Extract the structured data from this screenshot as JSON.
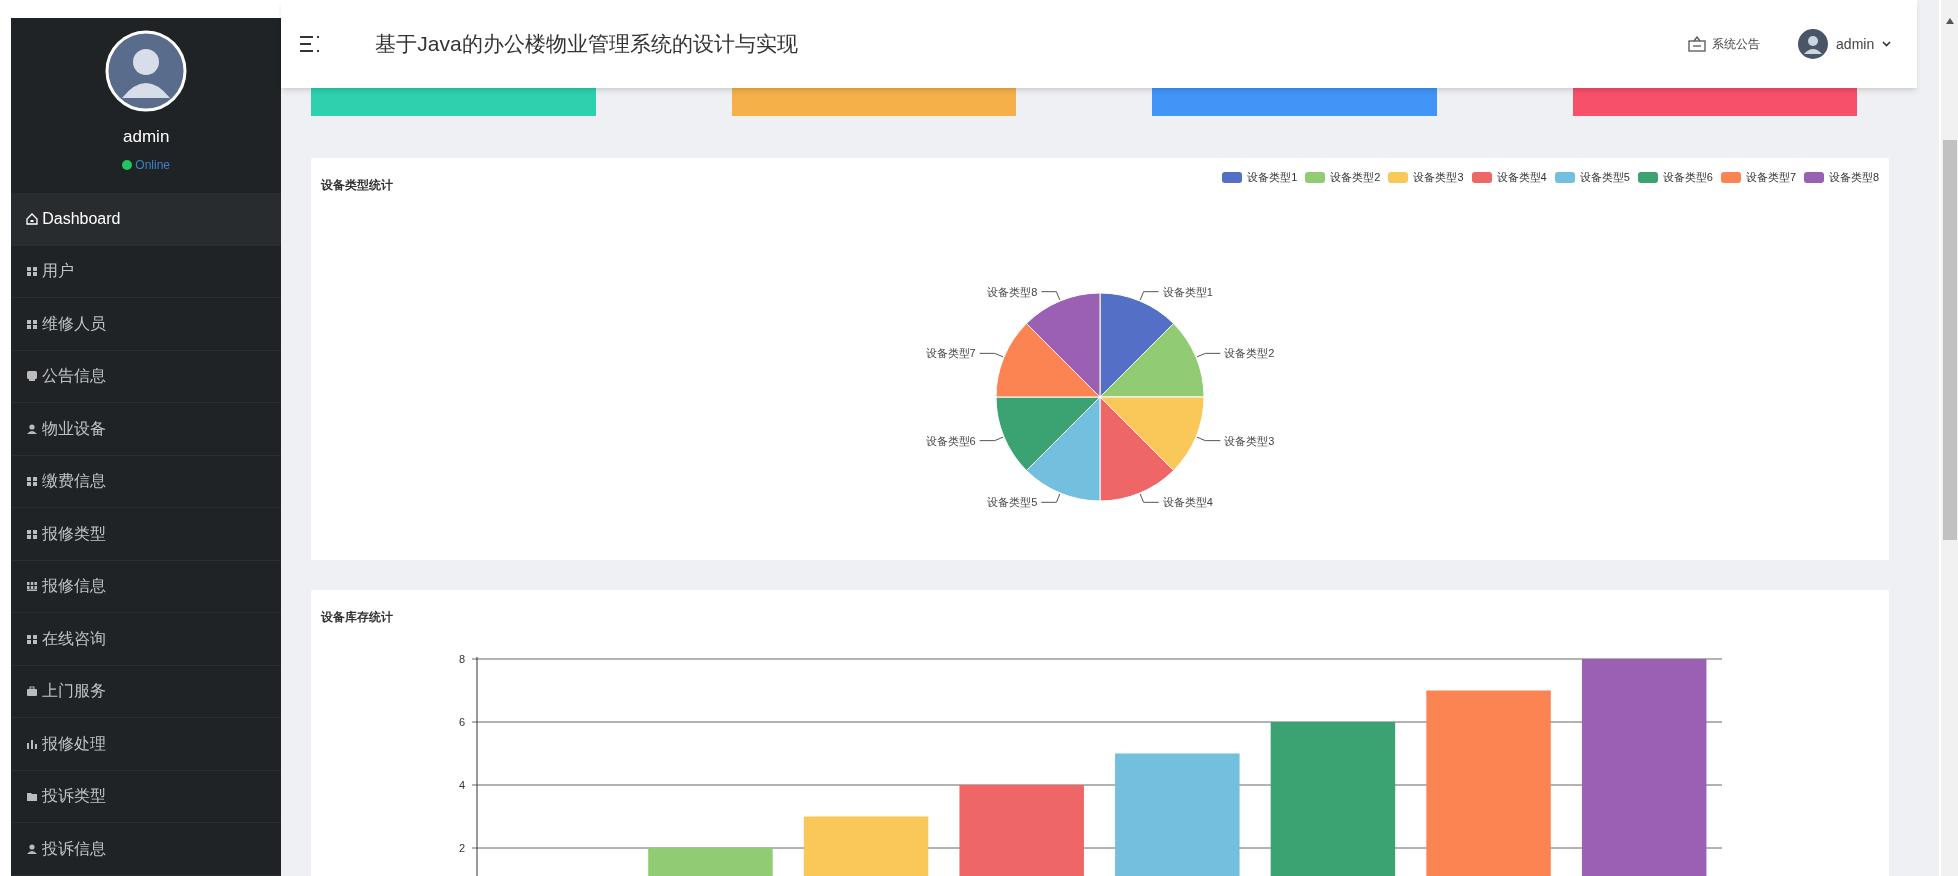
{
  "sidebar": {
    "user": {
      "name": "admin",
      "status": "Online"
    },
    "items": [
      {
        "label": "Dashboard",
        "selected": true
      },
      {
        "label": "用户",
        "selected": false
      },
      {
        "label": "维修人员",
        "selected": false
      },
      {
        "label": "公告信息",
        "selected": false
      },
      {
        "label": "物业设备",
        "selected": false
      },
      {
        "label": "缴费信息",
        "selected": false
      },
      {
        "label": "报修类型",
        "selected": false
      },
      {
        "label": "报修信息",
        "selected": false
      },
      {
        "label": "在线咨询",
        "selected": false
      },
      {
        "label": "上门服务",
        "selected": false
      },
      {
        "label": "报修处理",
        "selected": false
      },
      {
        "label": "投诉类型",
        "selected": false
      },
      {
        "label": "投诉信息",
        "selected": false
      }
    ]
  },
  "header": {
    "title": "基于Java的办公楼物业管理系统的设计与实现",
    "notice": "系统公告",
    "user": "admin"
  },
  "stat_cards": [
    {
      "color": "#2fd0ae"
    },
    {
      "color": "#f5b04a"
    },
    {
      "color": "#4095f6"
    },
    {
      "color": "#f6506b"
    }
  ],
  "panels": [
    {
      "title": "设备类型统计",
      "chart_data": {
        "type": "pie",
        "categories": [
          "设备类型1",
          "设备类型2",
          "设备类型3",
          "设备类型4",
          "设备类型5",
          "设备类型6",
          "设备类型7",
          "设备类型8"
        ],
        "series": [
          {
            "values": [
              1,
              1,
              1,
              1,
              1,
              1,
              1,
              1
            ]
          }
        ],
        "colors": [
          "#5470c6",
          "#91cc75",
          "#fac858",
          "#ee6666",
          "#73c0de",
          "#3ba272",
          "#fc8452",
          "#9a60b4"
        ]
      }
    },
    {
      "title": "设备库存统计",
      "chart_data": {
        "type": "bar",
        "grid": true,
        "series": [
          {
            "values": [
              null,
              2,
              3,
              4,
              5,
              6,
              7,
              8
            ]
          }
        ],
        "colors": [
          null,
          "#91cc75",
          "#fac858",
          "#ee6666",
          "#73c0de",
          "#3ba272",
          "#fc8452",
          "#9a60b4"
        ],
        "ylim": [
          0,
          8
        ],
        "yticks": [
          2,
          4,
          6,
          8
        ]
      }
    }
  ]
}
